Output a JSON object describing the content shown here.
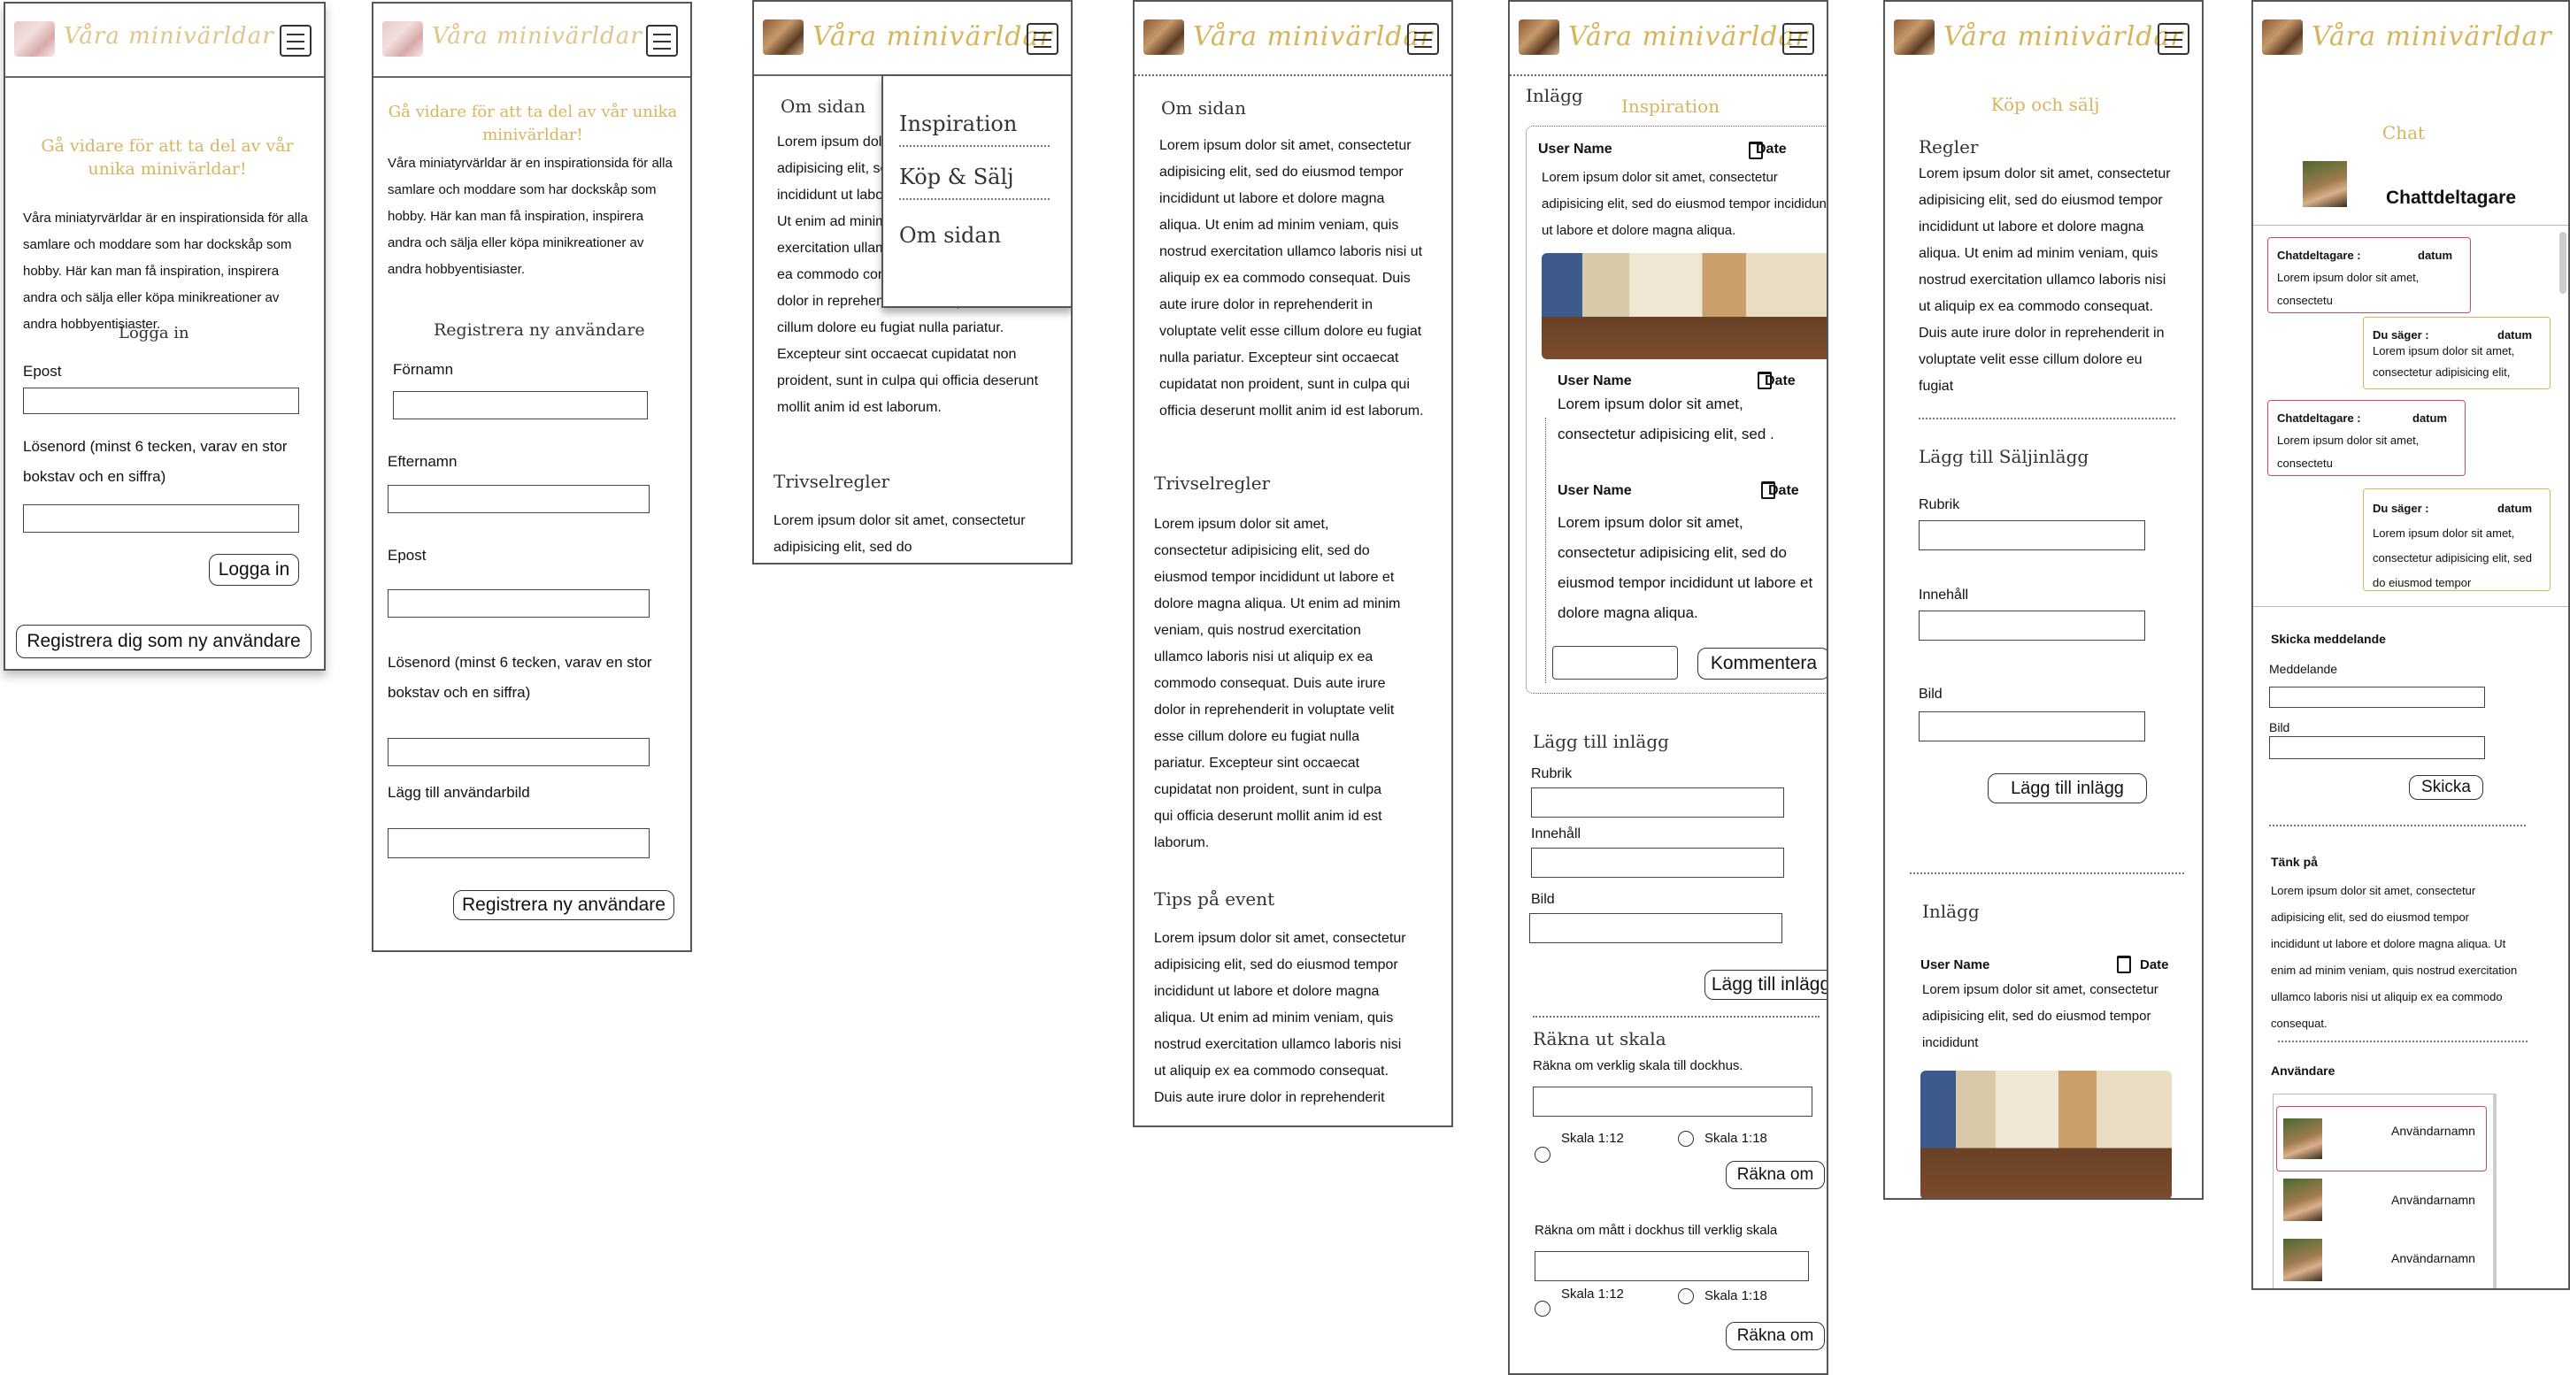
{
  "brand": {
    "logo_text": "Våra minivärldar",
    "accent": "#d9b45f"
  },
  "login": {
    "heading": "Gå vidare för att ta del av vår unika minivärldar!",
    "intro": "Våra miniatyrvärldar är en inspirationsida för alla samlare och moddare som har dockskåp som hobby. Här kan man få inspiration, inspirera andra och sälja eller köpa minikreationer av andra hobbyentisiaster.",
    "section_title": "Logga in",
    "email_label": "Epost",
    "password_label": "Lösenord (minst 6 tecken, varav en stor bokstav och en siffra)",
    "login_button": "Logga in",
    "register_link": "Registrera dig som ny användare"
  },
  "register": {
    "heading": "Gå vidare för att ta del av vår unika minivärldar!",
    "intro": "Våra miniatyrvärldar är en inspirationsida för alla samlare och moddare som har dockskåp som hobby. Här kan man få inspiration, inspirera andra och sälja eller köpa minikreationer av andra hobbyentisiaster.",
    "section_title": "Registrera ny användare",
    "first_name_label": "Förnamn",
    "last_name_label": "Efternamn",
    "email_label": "Epost",
    "password_label": "Lösenord (minst 6 tecken, varav en stor bokstav och en siffra)",
    "avatar_label": "Lägg till användarbild",
    "submit_button": "Registrera ny användare"
  },
  "menu_open": {
    "about_title": "Om sidan",
    "about_text": "Lorem ipsum dolor sit amet, consectetur adipisicing elit, sed do eiusmod tempor incididunt ut labore et dolore magna aliqua. Ut enim ad minim veniam, quis nostrud exercitation ullamco laboris nisi ut aliquip ex ea commodo consequat. Duis aute irure dolor in reprehenderit in voluptate velit esse cillum dolore eu fugiat nulla pariatur. Excepteur sint occaecat cupidatat non proident, sunt in culpa qui officia deserunt mollit anim id est laborum.",
    "rules_title": "Trivselregler",
    "rules_text": "Lorem ipsum dolor sit amet, consectetur adipisicing elit, sed do",
    "menu_items": [
      "Inspiration",
      "Köp & Sälj",
      "Om sidan"
    ]
  },
  "about": {
    "about_title": "Om sidan",
    "about_text": "Lorem ipsum dolor sit amet, consectetur adipisicing elit, sed do eiusmod tempor incididunt ut labore et dolore magna aliqua. Ut enim ad minim veniam, quis nostrud exercitation ullamco laboris nisi ut aliquip ex ea commodo consequat. Duis aute irure dolor in reprehenderit in voluptate velit esse cillum dolore eu fugiat nulla pariatur. Excepteur sint occaecat cupidatat non proident, sunt in culpa qui officia deserunt mollit anim id est laborum.",
    "rules_title": "Trivselregler",
    "rules_text": "Lorem ipsum dolor sit amet, consectetur adipisicing elit, sed do eiusmod tempor incididunt ut labore et dolore magna aliqua. Ut enim ad minim veniam, quis nostrud exercitation ullamco laboris nisi ut aliquip ex ea commodo consequat. Duis aute irure dolor in reprehenderit in voluptate velit esse cillum dolore eu fugiat nulla pariatur. Excepteur sint occaecat cupidatat non proident, sunt in culpa qui officia deserunt mollit anim id est laborum.",
    "tips_title": "Tips på event",
    "tips_text": "Lorem ipsum dolor sit amet, consectetur adipisicing elit, sed do eiusmod tempor incididunt ut labore et dolore magna aliqua. Ut enim ad minim veniam, quis nostrud exercitation ullamco laboris nisi ut aliquip ex ea commodo consequat. Duis aute irure dolor in reprehenderit"
  },
  "inspiration": {
    "page_title": "Inspiration",
    "section_label": "Inlägg",
    "post_user": "User Name",
    "post_date": "Date",
    "post_text": "Lorem ipsum dolor sit amet, consectetur adipisicing elit, sed do eiusmod tempor incididunt ut labore et dolore magna aliqua.",
    "comment1_user": "User Name",
    "comment1_date": "Date",
    "comment1_text": "Lorem ipsum dolor sit amet, consectetur adipisicing elit, sed .",
    "comment2_user": "User Name",
    "comment2_date": "Date",
    "comment2_text": "Lorem ipsum dolor sit amet, consectetur adipisicing elit, sed do eiusmod tempor incididunt ut labore et dolore magna aliqua.",
    "comment_button": "Kommentera",
    "add_title": "Lägg till inlägg",
    "rubrik_label": "Rubrik",
    "content_label": "Innehåll",
    "image_label": "Bild",
    "add_button": "Lägg till inlägg",
    "calc_title": "Räkna ut skala",
    "calc1_label": "Räkna om verklig skala till dockhus.",
    "scale_a": "Skala 1:12",
    "scale_b": "Skala 1:18",
    "recalc_button": "Räkna om",
    "calc2_label": "Räkna om mått i dockhus till verklig skala"
  },
  "market": {
    "page_title": "Köp och sälj",
    "rules_title": "Regler",
    "rules_text": "Lorem ipsum dolor sit amet, consectetur adipisicing elit, sed do eiusmod tempor incididunt ut labore et dolore magna aliqua. Ut enim ad minim veniam, quis nostrud exercitation ullamco laboris nisi ut aliquip ex ea commodo consequat. Duis aute irure dolor in reprehenderit in voluptate velit esse cillum dolore eu fugiat",
    "add_title": "Lägg till Säljinlägg",
    "rubrik_label": "Rubrik",
    "content_label": "Innehåll",
    "image_label": "Bild",
    "add_button": "Lägg till inlägg",
    "posts_title": "Inlägg",
    "post_user": "User Name",
    "post_date": "Date",
    "post_text": "Lorem ipsum dolor sit amet, consectetur adipisicing elit, sed do eiusmod tempor incididunt"
  },
  "chat": {
    "page_title": "Chat",
    "participant": "Chattdeltagare",
    "msg1_sender": "Chatdeltagare :",
    "msg1_date": "datum",
    "msg1_text": "Lorem ipsum dolor sit amet, consectetu",
    "msg2_sender": "Du säger :",
    "msg2_date": "datum",
    "msg2_text": "Lorem ipsum dolor sit amet, consectetur adipisicing elit,",
    "msg3_sender": "Chatdeltagare :",
    "msg3_date": "datum",
    "msg3_text": "Lorem ipsum dolor sit amet, consectetu",
    "msg4_sender": "Du säger :",
    "msg4_date": "datum",
    "msg4_text": "Lorem ipsum dolor sit amet, consectetur adipisicing elit, sed do eiusmod tempor",
    "send_title": "Skicka meddelande",
    "message_label": "Meddelande",
    "image_label": "Bild",
    "send_button": "Skicka",
    "think_title": "Tänk på",
    "think_text": "Lorem ipsum dolor sit amet, consectetur adipisicing elit, sed do eiusmod tempor incididunt ut labore et dolore magna aliqua. Ut enim ad minim veniam, quis nostrud exercitation ullamco laboris nisi ut aliquip ex ea commodo consequat.",
    "users_title": "Användare",
    "users": [
      "Användarnamn",
      "Användarnamn",
      "Användarnamn"
    ]
  }
}
